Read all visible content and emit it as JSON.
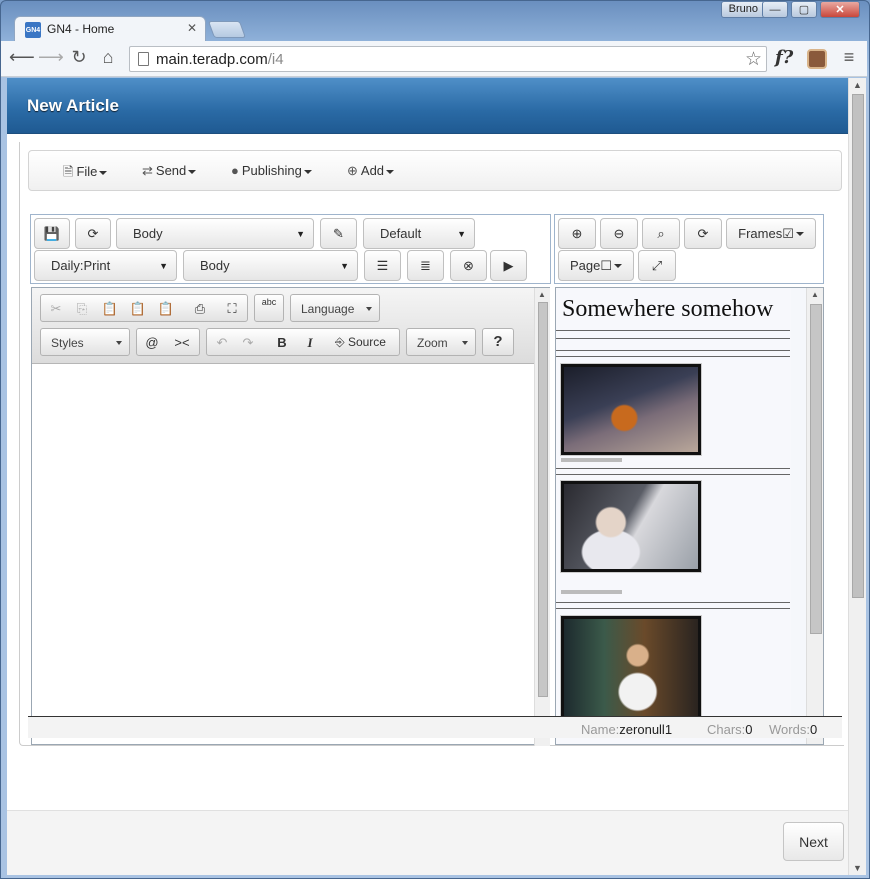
{
  "browser": {
    "user": "Bruno",
    "tab_title": "GN4 - Home",
    "tab_favicon": "GN4",
    "url_host": "main.teradp.com",
    "url_path": "/i4",
    "ext_label": "f?"
  },
  "dialog": {
    "title": "New Article"
  },
  "menu": [
    {
      "label": "File",
      "icon": "file-icon"
    },
    {
      "label": "Send",
      "icon": "transfer-icon"
    },
    {
      "label": "Publishing",
      "icon": "globe-icon"
    },
    {
      "label": "Add",
      "icon": "plus-circle-icon"
    }
  ],
  "toolbar": {
    "body_select": "Body",
    "default_select": "Default",
    "edition_select": "Daily:Print",
    "body_select_2": "Body",
    "frames_label": "Frames",
    "page_label": "Page"
  },
  "editor": {
    "language_label": "Language",
    "styles_label": "Styles",
    "source_label": "Source",
    "zoom_label": "Zoom",
    "help_label": "?",
    "at_label": "@",
    "split_label": "><",
    "bold_label": "B",
    "italic_label": "I",
    "spell_label": "abc"
  },
  "preview": {
    "headline": "Somewhere somehow"
  },
  "status": {
    "name_key": "Name:",
    "name_val": "zeronull1",
    "chars_key": "Chars:",
    "chars_val": "0",
    "words_key": "Words:",
    "words_val": "0"
  },
  "footer": {
    "next_label": "Next"
  }
}
